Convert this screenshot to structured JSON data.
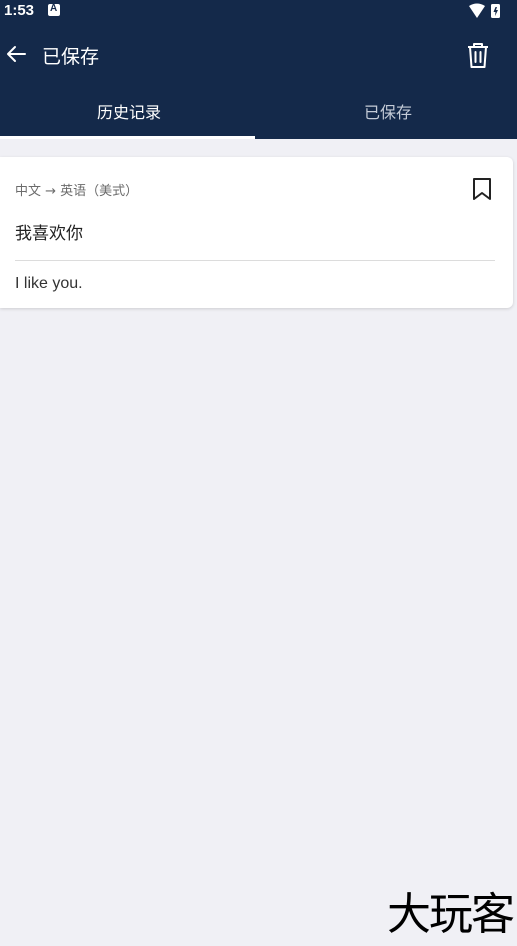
{
  "status_bar": {
    "time": "1:53"
  },
  "toolbar": {
    "title": "已保存"
  },
  "tabs": [
    {
      "label": "历史记录",
      "active": true
    },
    {
      "label": "已保存",
      "active": false
    }
  ],
  "card": {
    "language_pair": "中文 → 英语（美式）",
    "source_text": "我喜欢你",
    "translated_text": "I like you."
  },
  "watermark": "大玩客",
  "colors": {
    "appbar": "#14294a",
    "background": "#f0f0f5",
    "card": "#ffffff"
  }
}
